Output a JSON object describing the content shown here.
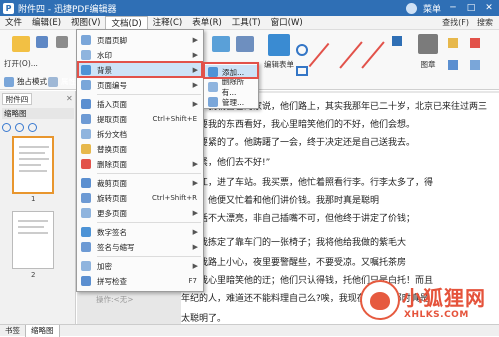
{
  "titlebar": {
    "title": "附件四 - 迅捷PDF编辑器",
    "user_label": "菜单"
  },
  "menubar": {
    "items": [
      "文件",
      "编辑(E)",
      "视图(V)",
      "文档(D)",
      "注释(C)",
      "表单(R)",
      "工具(T)",
      "窗口(W)"
    ],
    "right": [
      "查找(F)",
      "搜索"
    ]
  },
  "ribbon": {
    "open_label": "打开(O)...",
    "single_mode": "独占模式",
    "properties": "属性(P)...",
    "edit_form": "编辑表单",
    "stamp": "图章"
  },
  "leftpanel": {
    "tab_label": "附件四",
    "header": "缩略图",
    "pages": [
      "1",
      "2"
    ]
  },
  "document": {
    "lines": [
      "路上，我朝自己的家说，他们路上，其实我那年已二十岁，北京已来往过两三",
      "。他要我的东西看好，我心里暗笑他们的不好，他们会想。",
      "什么要紧的了。他踌躇了一会，终于决定还是自己送我去。",
      "不要紧，他们去不好!”",
      "过了江，进了车站。我买票，他忙着照看行李。行李太多了，得",
      "过去。他便又忙着和他们讲价钱。我那时真是聪明",
      "他说话不大漂亮，非自己插嘴不可，但他终于讲定了价钱；",
      "他给我拣定了靠车门的一张椅子；我将他给我做的紫毛大",
      "他嘱我路上小心，夜里要警醒些，不要受凉。又嘱托茶房",
      "我，我心里暗笑他的迂；他们只认得钱，托他们只是白托！而且",
      "年纪的人，难道还不能料理自己么?唉，我现在想想，那时真是",
      "太聪明了。"
    ]
  },
  "dropdown": {
    "items": [
      {
        "label": "页眉页脚",
        "has_sub": true
      },
      {
        "label": "水印",
        "has_sub": true
      },
      {
        "label": "背景",
        "has_sub": true
      },
      {
        "label": "页面编号",
        "has_sub": true
      },
      {
        "label": "插入页面",
        "has_sub": true
      },
      {
        "label": "提取页面",
        "shortcut": "Ctrl+Shift+E"
      },
      {
        "label": "拆分文档"
      },
      {
        "label": "替换页面"
      },
      {
        "label": "删除页面"
      },
      {
        "label": "裁剪页面",
        "has_sub": true
      },
      {
        "label": "旋转页面",
        "shortcut": "Ctrl+Shift+R"
      },
      {
        "label": "更多页面",
        "has_sub": true
      },
      {
        "label": "数字签名",
        "has_sub": true
      },
      {
        "label": "签名与缩写",
        "has_sub": true
      },
      {
        "label": "加密",
        "has_sub": true
      },
      {
        "label": "拼写检查",
        "shortcut": "F7"
      },
      {
        "label": "操作:<无>",
        "disabled": true
      }
    ]
  },
  "submenu": {
    "items": [
      "添加...",
      "删除所有...",
      "管理..."
    ]
  },
  "statusbar": {
    "tabs": [
      "书签",
      "缩略图"
    ]
  },
  "watermark": {
    "brand": "小狐狸网",
    "domain": "XHLKS.COM"
  },
  "colors": {
    "titlebar": "#2f6fb5",
    "highlight": "#cde3f7",
    "redbox": "#e2524a"
  }
}
